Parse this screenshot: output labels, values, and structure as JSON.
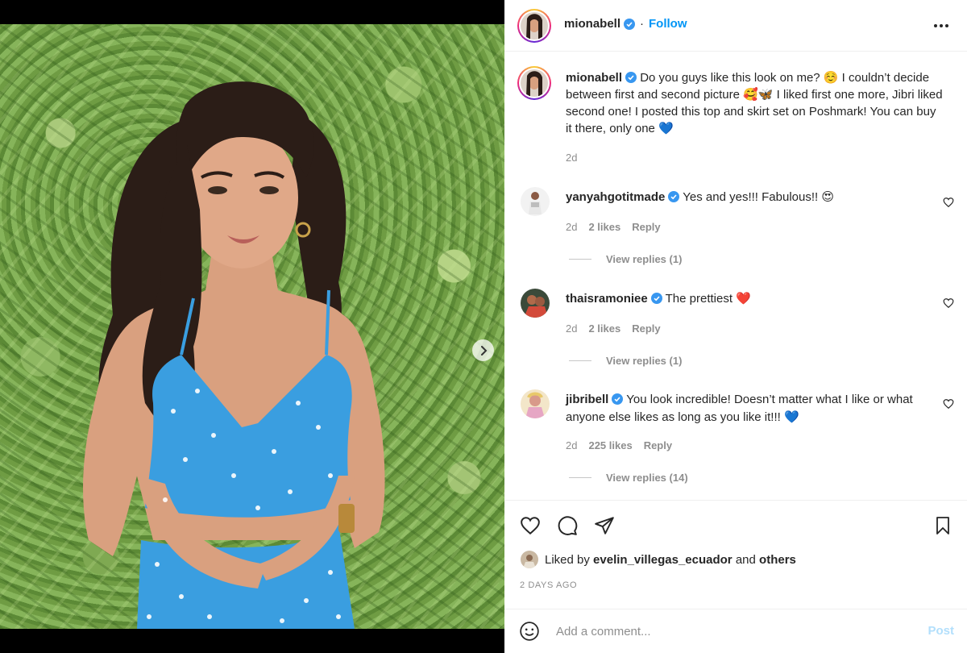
{
  "post": {
    "username": "mionabell",
    "follow_label": "Follow",
    "separator": "·",
    "caption": {
      "text": "Do you guys like this look on me? ☺️ I couldn’t decide between first and second picture 🥰🦋 I liked first one more, Jibri liked second one! I posted this top and skirt set on Poshmark! You can buy it there, only one 💙",
      "time": "2d"
    }
  },
  "comments": [
    {
      "username": "yanyahgotitmade",
      "text": "Yes and yes!!! Fabulous!! 😍",
      "time": "2d",
      "likes": "2 likes",
      "reply_label": "Reply",
      "view_replies": "View replies (1)"
    },
    {
      "username": "thaisramoniee",
      "text": "The prettiest ❤️",
      "time": "2d",
      "likes": "2 likes",
      "reply_label": "Reply",
      "view_replies": "View replies (1)"
    },
    {
      "username": "jibribell",
      "text": "You look incredible! Doesn’t matter what I like or what anyone else likes as long as you like it!!! 💙",
      "time": "2d",
      "likes": "225 likes",
      "reply_label": "Reply",
      "view_replies": "View replies (14)"
    }
  ],
  "likes": {
    "prefix": "Liked by",
    "user": "evelin_villegas_ecuador",
    "and": "and",
    "others": "others"
  },
  "date_label": "2 DAYS AGO",
  "add_comment": {
    "placeholder": "Add a comment...",
    "post_label": "Post"
  },
  "colors": {
    "link_blue": "#0095f6",
    "verified_blue": "#3897f0",
    "muted_text": "#8e8e8e",
    "dress_blue": "#3a9ee0"
  },
  "icons": [
    "verified-icon",
    "more-icon",
    "chevron-right-icon",
    "heart-icon",
    "comment-icon",
    "share-icon",
    "bookmark-icon",
    "emoji-icon"
  ]
}
